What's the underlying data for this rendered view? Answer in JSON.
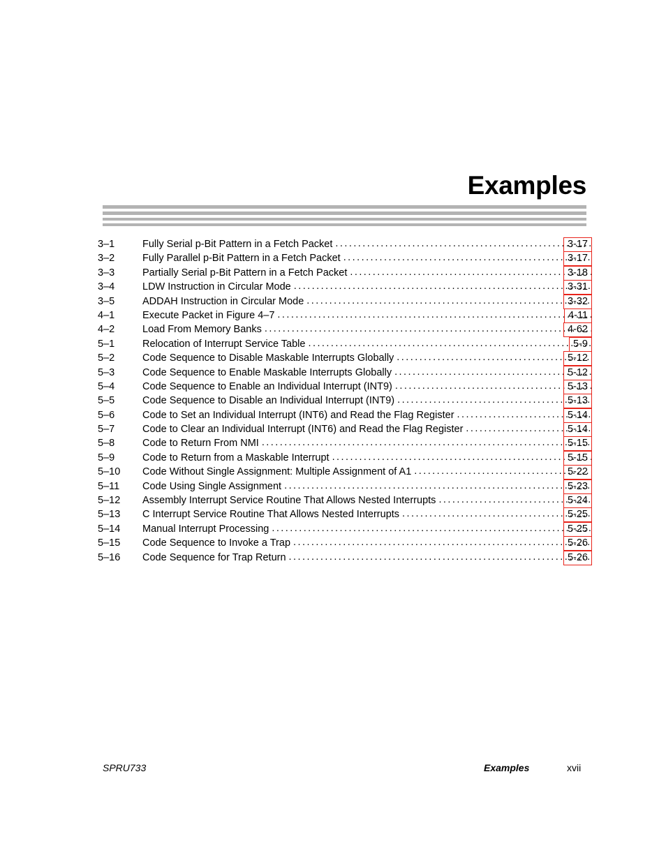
{
  "document": {
    "title": "Examples",
    "rule_color": "#b3b3b3",
    "pagebox_border_color": "#e8231a"
  },
  "examples_list": {
    "heading": "Examples",
    "entries": [
      {
        "number": "3–1",
        "title": "Fully Serial p-Bit Pattern in a Fetch Packet",
        "page": "3-17"
      },
      {
        "number": "3–2",
        "title": "Fully Parallel p-Bit Pattern in a Fetch Packet",
        "page": "3-17"
      },
      {
        "number": "3–3",
        "title": "Partially Serial p-Bit Pattern in a Fetch Packet",
        "page": "3-18"
      },
      {
        "number": "3–4",
        "title": "LDW Instruction in Circular Mode",
        "page": "3-31"
      },
      {
        "number": "3–5",
        "title": "ADDAH Instruction in Circular Mode",
        "page": "3-32"
      },
      {
        "number": "4–1",
        "title": "Execute Packet in Figure 4–7",
        "page": "4-11"
      },
      {
        "number": "4–2",
        "title": "Load From Memory Banks",
        "page": "4-62"
      },
      {
        "number": "5–1",
        "title": "Relocation of Interrupt Service Table",
        "page": "5-9"
      },
      {
        "number": "5–2",
        "title": "Code Sequence to Disable Maskable Interrupts Globally",
        "page": "5-12"
      },
      {
        "number": "5–3",
        "title": "Code Sequence to Enable Maskable Interrupts Globally",
        "page": "5-12"
      },
      {
        "number": "5–4",
        "title": "Code Sequence to Enable an Individual Interrupt (INT9)",
        "page": "5-13"
      },
      {
        "number": "5–5",
        "title": "Code Sequence to Disable an Individual Interrupt (INT9)",
        "page": "5-13"
      },
      {
        "number": "5–6",
        "title": "Code to Set an Individual Interrupt (INT6) and Read the Flag Register",
        "page": "5-14"
      },
      {
        "number": "5–7",
        "title": "Code to Clear an Individual Interrupt (INT6) and Read the Flag Register",
        "page": "5-14"
      },
      {
        "number": "5–8",
        "title": "Code to Return From NMI",
        "page": "5-15"
      },
      {
        "number": "5–9",
        "title": "Code to Return from a Maskable Interrupt",
        "page": "5-15"
      },
      {
        "number": "5–10",
        "title": "Code Without Single Assignment: Multiple Assignment of A1",
        "page": "5-22"
      },
      {
        "number": "5–11",
        "title": "Code Using Single Assignment",
        "page": "5-23"
      },
      {
        "number": "5–12",
        "title": "Assembly Interrupt Service Routine That Allows Nested Interrupts",
        "page": "5-24"
      },
      {
        "number": "5–13",
        "title": "C Interrupt Service Routine That Allows Nested Interrupts",
        "page": "5-25"
      },
      {
        "number": "5–14",
        "title": "Manual Interrupt Processing",
        "page": "5-25"
      },
      {
        "number": "5–15",
        "title": "Code Sequence to Invoke a Trap",
        "page": "5-26"
      },
      {
        "number": "5–16",
        "title": "Code Sequence for Trap Return",
        "page": "5-26"
      }
    ]
  },
  "footer": {
    "document_number": "SPRU733",
    "section": "Examples",
    "page_number": "xvii"
  }
}
